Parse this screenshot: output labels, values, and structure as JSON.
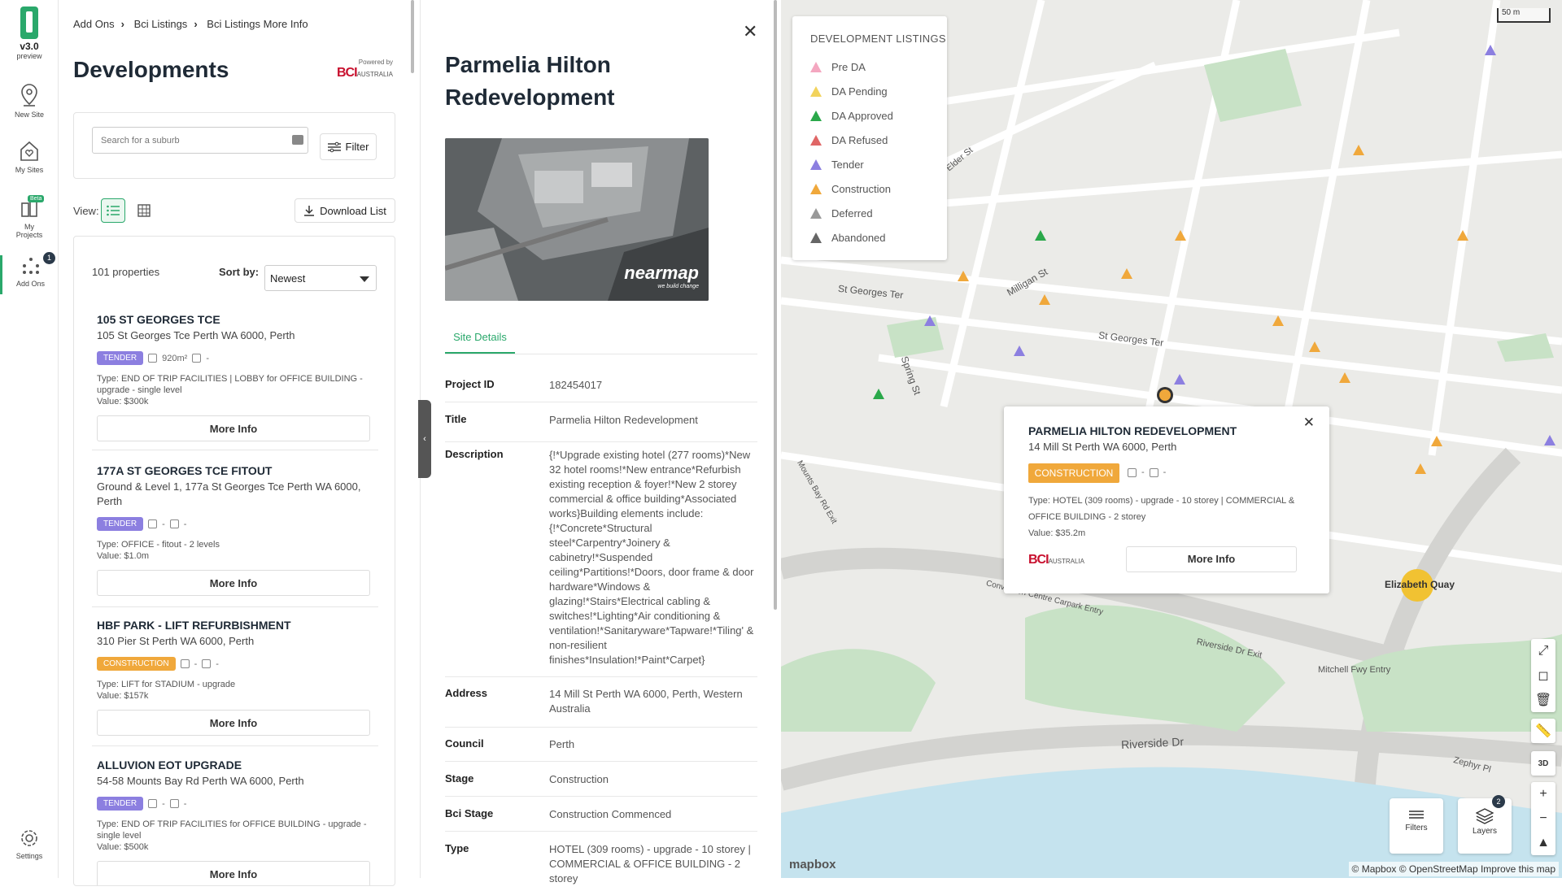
{
  "app": {
    "version": "v3.0",
    "version_sub": "preview"
  },
  "rail": {
    "new_site": "New Site",
    "my_sites": "My Sites",
    "my_projects_line1": "My",
    "my_projects_line2": "Projects",
    "beta": "Beta",
    "add_ons": "Add Ons",
    "add_ons_count": "1",
    "settings": "Settings"
  },
  "breadcrumb": [
    "Add Ons",
    "Bci Listings",
    "Bci Listings More Info"
  ],
  "panel": {
    "title": "Developments",
    "powered_by": "Powered by",
    "bci_logo": "BCI",
    "bci_logo_sub": "AUSTRALIA",
    "search_placeholder": "Search for a suburb",
    "filter_label": "Filter",
    "view_label": "View:",
    "download_label": "Download List",
    "count": "101 properties",
    "sort_label": "Sort by:",
    "sort_value": "Newest"
  },
  "listings": [
    {
      "title": "105 ST GEORGES TCE",
      "address": "105 St Georges Tce Perth WA 6000, Perth",
      "stage": "TENDER",
      "area": "920m²",
      "lots": "-",
      "type": "Type: END OF TRIP FACILITIES | LOBBY for OFFICE BUILDING - upgrade - single level",
      "value": "Value: $300k",
      "more": "More Info"
    },
    {
      "title": "177A ST GEORGES TCE FITOUT",
      "address": "Ground & Level 1, 177a St Georges Tce Perth WA 6000, Perth",
      "stage": "TENDER",
      "area": "-",
      "lots": "-",
      "type": "Type: OFFICE - fitout - 2 levels",
      "value": "Value: $1.0m",
      "more": "More Info"
    },
    {
      "title": "HBF PARK - LIFT REFURBISHMENT",
      "address": "310 Pier St Perth WA 6000, Perth",
      "stage": "CONSTRUCTION",
      "area": "-",
      "lots": "-",
      "type": "Type: LIFT for STADIUM - upgrade",
      "value": "Value: $157k",
      "more": "More Info"
    },
    {
      "title": "ALLUVION EOT UPGRADE",
      "address": "54-58 Mounts Bay Rd Perth WA 6000, Perth",
      "stage": "TENDER",
      "area": "-",
      "lots": "-",
      "type": "Type: END OF TRIP FACILITIES for OFFICE BUILDING - upgrade - single level",
      "value": "Value: $500k",
      "more": "More Info"
    }
  ],
  "detail": {
    "title": "Parmelia Hilton Redevelopment",
    "nearmap": "nearmap",
    "nearmap_sub": "we build change",
    "tab": "Site Details",
    "rows": [
      {
        "k": "Project ID",
        "v": "182454017"
      },
      {
        "k": "Title",
        "v": "Parmelia Hilton Redevelopment"
      },
      {
        "k": "Description",
        "v": "{!*Upgrade existing hotel (277 rooms)*New 32 hotel rooms!*New entrance*Refurbish existing reception & foyer!*New 2 storey commercial & office building*Associated works}Building elements include:{!*Concrete*Structural steel*Carpentry*Joinery & cabinetry!*Suspended ceiling*Partitions!*Doors, door frame & door hardware*Windows & glazing!*Stairs*Electrical cabling & switches!*Lighting*Air conditioning & ventilation!*Sanitaryware*Tapware!*Tiling' & non-resilient finishes*Insulation!*Paint*Carpet}"
      },
      {
        "k": "Address",
        "v": "14 Mill St Perth WA 6000, Perth, Western Australia"
      },
      {
        "k": "Council",
        "v": "Perth"
      },
      {
        "k": "Stage",
        "v": "Construction"
      },
      {
        "k": "Bci Stage",
        "v": "Construction Commenced"
      },
      {
        "k": "Type",
        "v": "HOTEL (309 rooms) - upgrade - 10 storey | COMMERCIAL & OFFICE BUILDING - 2 storey"
      }
    ]
  },
  "legend": {
    "title": "DEVELOPMENT LISTINGS",
    "items": [
      {
        "label": "Pre DA",
        "color": "#f4a7c0"
      },
      {
        "label": "DA Pending",
        "color": "#f2d35c"
      },
      {
        "label": "DA Approved",
        "color": "#2aa84a"
      },
      {
        "label": "DA Refused",
        "color": "#e06666"
      },
      {
        "label": "Tender",
        "color": "#8c7fe0"
      },
      {
        "label": "Construction",
        "color": "#f0a83b"
      },
      {
        "label": "Deferred",
        "color": "#999999"
      },
      {
        "label": "Abandoned",
        "color": "#666666"
      }
    ]
  },
  "popup": {
    "title": "PARMELIA HILTON REDEVELOPMENT",
    "address": "14 Mill St Perth WA 6000, Perth",
    "stage": "CONSTRUCTION",
    "area": "-",
    "lots": "-",
    "type": "Type: HOTEL (309 rooms) - upgrade - 10 storey | COMMERCIAL & OFFICE BUILDING - 2 storey",
    "value": "Value: $35.2m",
    "more": "More Info"
  },
  "map": {
    "scale": "50 m",
    "streets": [
      "St Georges Ter",
      "St Georges Ter",
      "Milligan St",
      "Spring St",
      "Riverside Dr",
      "Riverside Dr Exit",
      "Mitchell Fwy Entry",
      "Convention Centre Carpark Entry",
      "Elizabeth Quay",
      "Zephyr Pl",
      "Elder St",
      "Mounts Bay Rd Exit"
    ],
    "filters": "Filters",
    "layers": "Layers",
    "layers_count": "2",
    "ctl_3d": "3D",
    "attribution": "© Mapbox © OpenStreetMap Improve this map",
    "mapbox": "mapbox"
  },
  "colors": {
    "accent": "#2aa86b",
    "tender": "#8c7fe0",
    "construction": "#f0a83b",
    "bci_red": "#c8102e"
  }
}
